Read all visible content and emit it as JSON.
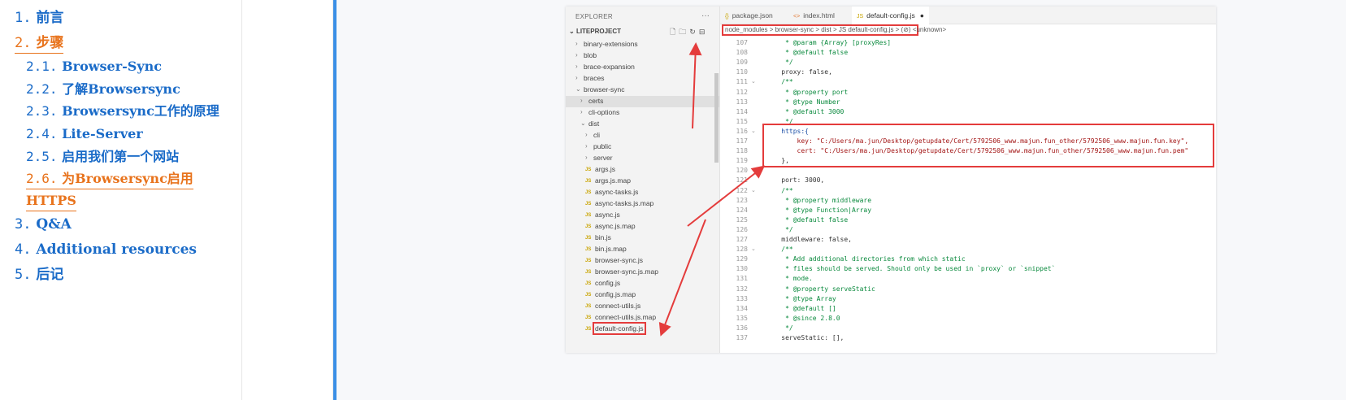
{
  "toc": {
    "items": [
      {
        "num": "1.",
        "label": "前言",
        "level": 1,
        "active": false
      },
      {
        "num": "2.",
        "label": "步骤",
        "level": 1,
        "active": true
      },
      {
        "num": "2.1.",
        "label": "Browser-Sync",
        "level": 2,
        "active": false
      },
      {
        "num": "2.2.",
        "label": "了解Browsersync",
        "level": 2,
        "active": false
      },
      {
        "num": "2.3.",
        "label": "Browsersync工作的原理",
        "level": 2,
        "active": false
      },
      {
        "num": "2.4.",
        "label": "Lite-Server",
        "level": 2,
        "active": false
      },
      {
        "num": "2.5.",
        "label": "启用我们第一个网站",
        "level": 2,
        "active": false
      },
      {
        "num": "2.6.",
        "label": "为Browsersync启用",
        "level": 2,
        "active": true
      },
      {
        "num": "",
        "label": "HTTPS",
        "level": 2,
        "active": true
      },
      {
        "num": "3.",
        "label": "Q&A",
        "level": 1,
        "active": false
      },
      {
        "num": "4.",
        "label": "Additional resources",
        "level": 1,
        "active": false
      },
      {
        "num": "5.",
        "label": "后记",
        "level": 1,
        "active": false
      }
    ]
  },
  "vscode": {
    "explorer_title": "EXPLORER",
    "more": "···",
    "project": "LITEPROJECT",
    "tree": [
      {
        "label": "binary-extensions",
        "kind": "folder",
        "indent": 1
      },
      {
        "label": "blob",
        "kind": "folder",
        "indent": 1
      },
      {
        "label": "brace-expansion",
        "kind": "folder",
        "indent": 1
      },
      {
        "label": "braces",
        "kind": "folder",
        "indent": 1
      },
      {
        "label": "browser-sync",
        "kind": "folder-open",
        "indent": 1
      },
      {
        "label": "certs",
        "kind": "folder",
        "indent": 2
      },
      {
        "label": "cli-options",
        "kind": "folder",
        "indent": 2
      },
      {
        "label": "dist",
        "kind": "folder-open",
        "indent": 2
      },
      {
        "label": "cli",
        "kind": "folder",
        "indent": 3
      },
      {
        "label": "public",
        "kind": "folder",
        "indent": 3
      },
      {
        "label": "server",
        "kind": "folder",
        "indent": 3
      },
      {
        "label": "args.js",
        "kind": "js",
        "indent": 3
      },
      {
        "label": "args.js.map",
        "kind": "js",
        "indent": 3
      },
      {
        "label": "async-tasks.js",
        "kind": "js",
        "indent": 3
      },
      {
        "label": "async-tasks.js.map",
        "kind": "js",
        "indent": 3
      },
      {
        "label": "async.js",
        "kind": "js",
        "indent": 3
      },
      {
        "label": "async.js.map",
        "kind": "js",
        "indent": 3
      },
      {
        "label": "bin.js",
        "kind": "js",
        "indent": 3
      },
      {
        "label": "bin.js.map",
        "kind": "js",
        "indent": 3
      },
      {
        "label": "browser-sync.js",
        "kind": "js",
        "indent": 3
      },
      {
        "label": "browser-sync.js.map",
        "kind": "js",
        "indent": 3
      },
      {
        "label": "config.js",
        "kind": "js",
        "indent": 3
      },
      {
        "label": "config.js.map",
        "kind": "js",
        "indent": 3
      },
      {
        "label": "connect-utils.js",
        "kind": "js",
        "indent": 3
      },
      {
        "label": "connect-utils.js.map",
        "kind": "js",
        "indent": 3
      },
      {
        "label": "default-config.js",
        "kind": "js",
        "indent": 3
      }
    ],
    "tabs": [
      {
        "icon": "{}",
        "label": "package.json",
        "active": false
      },
      {
        "icon": "<>",
        "label": "index.html",
        "active": false
      },
      {
        "icon": "JS",
        "label": "default-config.js",
        "active": true
      }
    ],
    "modified_dot": "●",
    "breadcrumb": "node_modules > browser-sync > dist > JS default-config.js > (⊘) <unknown>",
    "code": [
      {
        "n": "107",
        "t": "     * @param {Array} [proxyRes]",
        "c": "cm"
      },
      {
        "n": "108",
        "t": "     * @default false",
        "c": "cm"
      },
      {
        "n": "109",
        "t": "     */",
        "c": "cm"
      },
      {
        "n": "110",
        "t": "    proxy: false,",
        "c": ""
      },
      {
        "n": "111",
        "t": "    /**",
        "c": "cm"
      },
      {
        "n": "112",
        "t": "     * @property port",
        "c": "cm"
      },
      {
        "n": "113",
        "t": "     * @type Number",
        "c": "cm"
      },
      {
        "n": "114",
        "t": "     * @default 3000",
        "c": "cm"
      },
      {
        "n": "115",
        "t": "     */",
        "c": "cm"
      },
      {
        "n": "116",
        "t": "    https:{",
        "c": "kw"
      },
      {
        "n": "117",
        "t": "        key: \"C:/Users/ma.jun/Desktop/getupdate/Cert/5792506_www.majun.fun_other/5792506_www.majun.fun.key\",",
        "c": "str"
      },
      {
        "n": "118",
        "t": "        cert: \"C:/Users/ma.jun/Desktop/getupdate/Cert/5792506_www.majun.fun_other/5792506_www.majun.fun.pem\"",
        "c": "str"
      },
      {
        "n": "119",
        "t": "    },",
        "c": ""
      },
      {
        "n": "120",
        "t": "",
        "c": ""
      },
      {
        "n": "121",
        "t": "    port: 3000,",
        "c": ""
      },
      {
        "n": "122",
        "t": "    /**",
        "c": "cm"
      },
      {
        "n": "123",
        "t": "     * @property middleware",
        "c": "cm"
      },
      {
        "n": "124",
        "t": "     * @type Function|Array",
        "c": "cm"
      },
      {
        "n": "125",
        "t": "     * @default false",
        "c": "cm"
      },
      {
        "n": "126",
        "t": "     */",
        "c": "cm"
      },
      {
        "n": "127",
        "t": "    middleware: false,",
        "c": ""
      },
      {
        "n": "128",
        "t": "    /**",
        "c": "cm"
      },
      {
        "n": "129",
        "t": "     * Add additional directories from which static",
        "c": "cm"
      },
      {
        "n": "130",
        "t": "     * files should be served. Should only be used in `proxy` or `snippet`",
        "c": "cm"
      },
      {
        "n": "131",
        "t": "     * mode.",
        "c": "cm"
      },
      {
        "n": "132",
        "t": "     * @property serveStatic",
        "c": "cm"
      },
      {
        "n": "133",
        "t": "     * @type Array",
        "c": "cm"
      },
      {
        "n": "134",
        "t": "     * @default []",
        "c": "cm"
      },
      {
        "n": "135",
        "t": "     * @since 2.8.0",
        "c": "cm"
      },
      {
        "n": "136",
        "t": "     */",
        "c": "cm"
      },
      {
        "n": "137",
        "t": "    serveStatic: [],",
        "c": ""
      }
    ]
  },
  "colors": {
    "toc_link": "#1a6bc8",
    "toc_active": "#e8731c",
    "annotation_red": "#e43c3c",
    "accent_bar": "#3a8fe6"
  }
}
